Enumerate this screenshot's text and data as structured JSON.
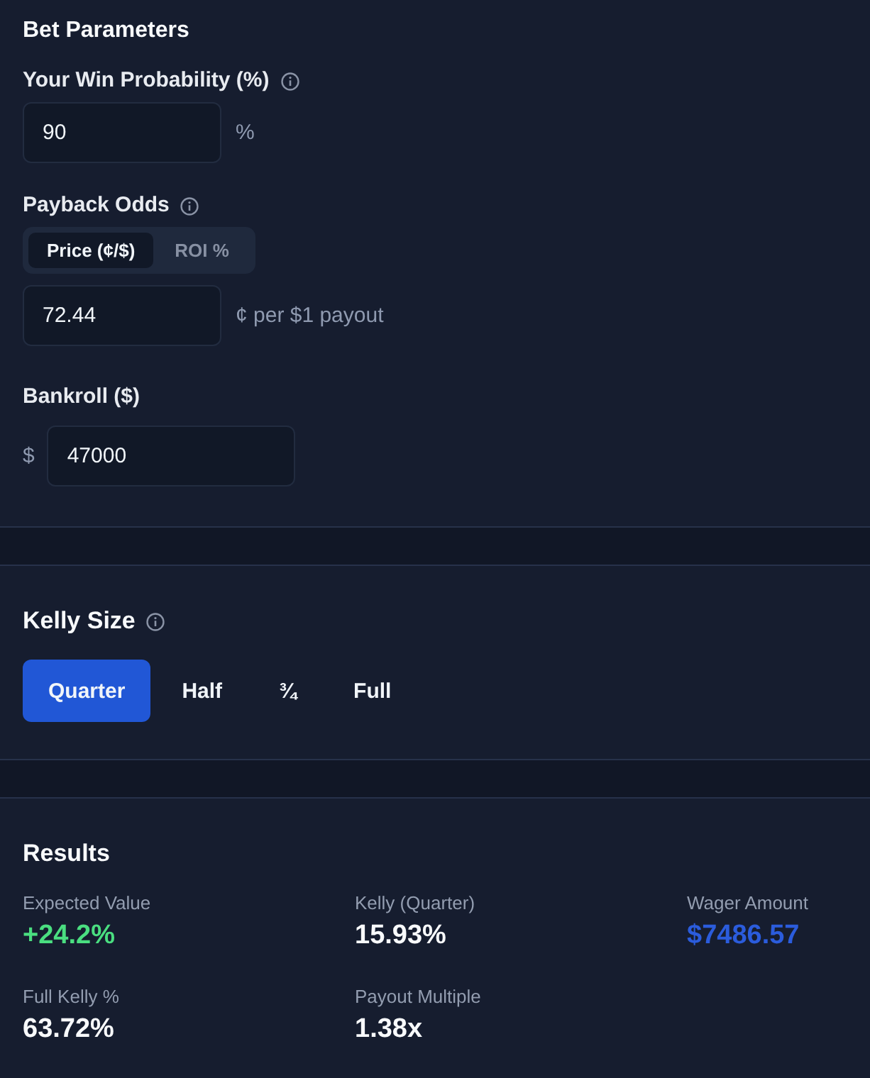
{
  "bet_parameters": {
    "title": "Bet Parameters",
    "win_probability": {
      "label": "Your Win Probability (%)",
      "value": "90",
      "unit": "%"
    },
    "payback_odds": {
      "label": "Payback Odds",
      "modes": [
        {
          "label": "Price (¢/$)",
          "selected": true
        },
        {
          "label": "ROI %",
          "selected": false
        }
      ],
      "value": "72.44",
      "unit": "¢ per $1 payout"
    },
    "bankroll": {
      "label": "Bankroll ($)",
      "prefix": "$",
      "value": "47000"
    }
  },
  "kelly_size": {
    "title": "Kelly Size",
    "options": [
      {
        "label": "Quarter",
        "selected": true
      },
      {
        "label": "Half",
        "selected": false
      },
      {
        "label": "¾",
        "selected": false
      },
      {
        "label": "Full",
        "selected": false
      }
    ]
  },
  "results": {
    "title": "Results",
    "metrics": [
      {
        "label": "Expected Value",
        "value": "+24.2%",
        "kind": "positive"
      },
      {
        "label": "Kelly (Quarter)",
        "value": "15.93%",
        "kind": "neutral"
      },
      {
        "label": "Wager Amount",
        "value": "$7486.57",
        "kind": "highlight"
      },
      {
        "label": "Full Kelly %",
        "value": "63.72%",
        "kind": "neutral"
      },
      {
        "label": "Payout Multiple",
        "value": "1.38x",
        "kind": "neutral"
      }
    ]
  }
}
